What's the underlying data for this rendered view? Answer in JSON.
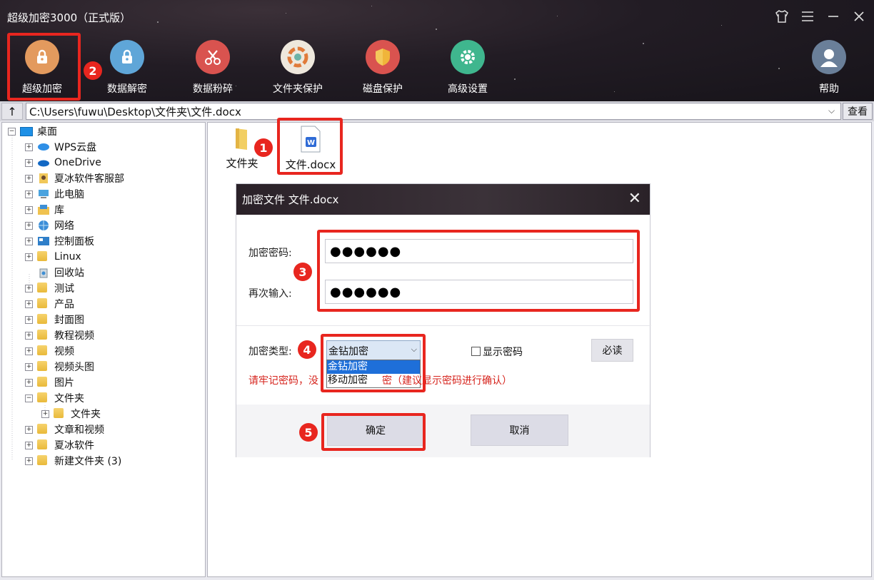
{
  "app": {
    "title": "超级加密3000（正式版）",
    "controls": {
      "skin": "shirt-icon",
      "menu": "menu-icon",
      "minimize": "minimize-icon",
      "close": "close-icon"
    }
  },
  "toolbar": {
    "items": [
      {
        "label": "超级加密",
        "icon": "lock-icon",
        "color": "#e39a5e"
      },
      {
        "label": "数据解密",
        "icon": "unlock-icon",
        "color": "#5fa6d8"
      },
      {
        "label": "数据粉碎",
        "icon": "scissors-icon",
        "color": "#d9534f"
      },
      {
        "label": "文件夹保护",
        "icon": "folder-protect-icon",
        "color": "#e8e2d8"
      },
      {
        "label": "磁盘保护",
        "icon": "shield-icon",
        "color": "#d9534f"
      },
      {
        "label": "高级设置",
        "icon": "gear-icon",
        "color": "#3fb68e"
      }
    ],
    "help": {
      "label": "帮助",
      "icon": "user-icon"
    }
  },
  "address": {
    "up": "↑",
    "path": "C:\\Users\\fuwu\\Desktop\\文件夹\\文件.docx",
    "view_label": "查看"
  },
  "tree": {
    "root": "桌面",
    "items": [
      "WPS云盘",
      "OneDrive",
      "夏冰软件客服部",
      "此电脑",
      "库",
      "网络",
      "控制面板",
      "Linux",
      "回收站",
      "测试",
      "产品",
      "封面图",
      "教程视频",
      "视频",
      "视频头图",
      "图片",
      "文件夹",
      "文件夹",
      "文章和视频",
      "夏冰软件",
      "新建文件夹 (3)"
    ]
  },
  "files": {
    "items": [
      {
        "label": "文件夹",
        "icon": "folder-icon"
      },
      {
        "label": "文件.docx",
        "icon": "word-doc-icon"
      }
    ]
  },
  "dialog": {
    "title": "加密文件 文件.docx",
    "password_label": "加密密码:",
    "password_value": "●●●●●●",
    "confirm_label": "再次输入:",
    "confirm_value": "●●●●●●",
    "type_label": "加密类型:",
    "type_selected": "金钻加密",
    "type_options": [
      "金钻加密",
      "移动加密"
    ],
    "show_password_label": "显示密码",
    "must_read_label": "必读",
    "warning": "请牢记密码，没                    密（建议显示密码进行确认）",
    "ok_label": "确定",
    "cancel_label": "取消"
  },
  "annotations": {
    "steps": [
      "1",
      "2",
      "3",
      "4",
      "5"
    ],
    "color": "#e8261f"
  }
}
